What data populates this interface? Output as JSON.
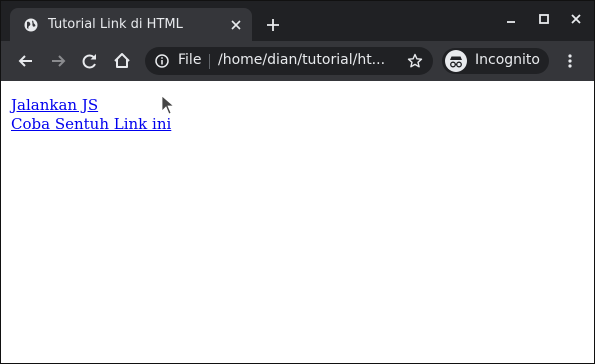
{
  "tab": {
    "title": "Tutorial Link di HTML",
    "favicon_icon": "globe-icon",
    "close_icon": "close-icon"
  },
  "new_tab_icon": "plus-icon",
  "window_controls": [
    "minimize-icon",
    "maximize-icon",
    "close-icon"
  ],
  "toolbar": {
    "back_icon": "arrow-left-icon",
    "forward_icon": "arrow-right-icon",
    "reload_icon": "reload-icon",
    "home_icon": "home-icon",
    "menu_icon": "vertical-dots-icon"
  },
  "omnibox": {
    "info_icon": "info-icon",
    "scheme": "File",
    "url": "/home/dian/tutorial/ht...",
    "bookmark_icon": "star-icon"
  },
  "incognito": {
    "icon": "incognito-icon",
    "label": "Incognito"
  },
  "page": {
    "links": [
      "Jalankan JS",
      "Coba Sentuh Link ini"
    ]
  },
  "colors": {
    "tabstrip_bg": "#202124",
    "toolbar_bg": "#35363a",
    "text": "#e8eaed",
    "link": "#0000ee",
    "page_bg": "#ffffff"
  }
}
